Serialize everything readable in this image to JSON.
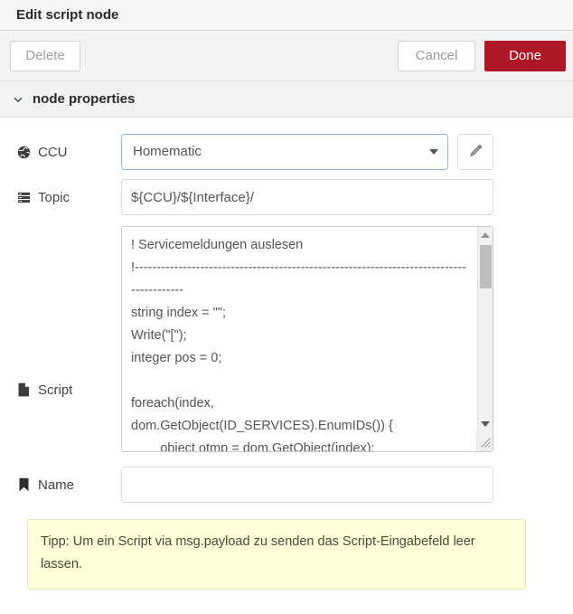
{
  "dialog": {
    "title": "Edit script node"
  },
  "toolbar": {
    "delete_label": "Delete",
    "cancel_label": "Cancel",
    "done_label": "Done",
    "done_color": "#ad1625"
  },
  "section": {
    "chevron_icon": "chevron-down-icon",
    "label": "node properties"
  },
  "fields": {
    "ccu": {
      "icon": "globe-icon",
      "label": "CCU",
      "selected_value": "Homematic",
      "dropdown_icon": "caret-down-icon",
      "edit_icon": "pencil-icon",
      "focus_color": "#8bb7e0"
    },
    "topic": {
      "icon": "list-bars-icon",
      "label": "Topic",
      "value": "${CCU}/${Interface}/",
      "placeholder": ""
    },
    "script": {
      "icon": "file-icon",
      "label": "Script",
      "value": "! Servicemeldungen auslesen\n!----------------------------------------------------------------------------------------\nstring index = \"\";\nWrite(\"[\");\ninteger pos = 0;\n\nforeach(index, dom.GetObject(ID_SERVICES).EnumIDs()) {\n        object otmp = dom.GetObject(index);",
      "scrollbar": {
        "up_icon": "scroll-up-arrow-icon",
        "down_icon": "scroll-down-arrow-icon",
        "resize_icon": "resize-grip-icon"
      }
    },
    "name": {
      "icon": "bookmark-icon",
      "label": "Name",
      "value": "",
      "placeholder": ""
    }
  },
  "tip": {
    "text": "Tipp: Um ein Script via msg.payload zu senden das Script-Eingabefeld leer lassen."
  }
}
